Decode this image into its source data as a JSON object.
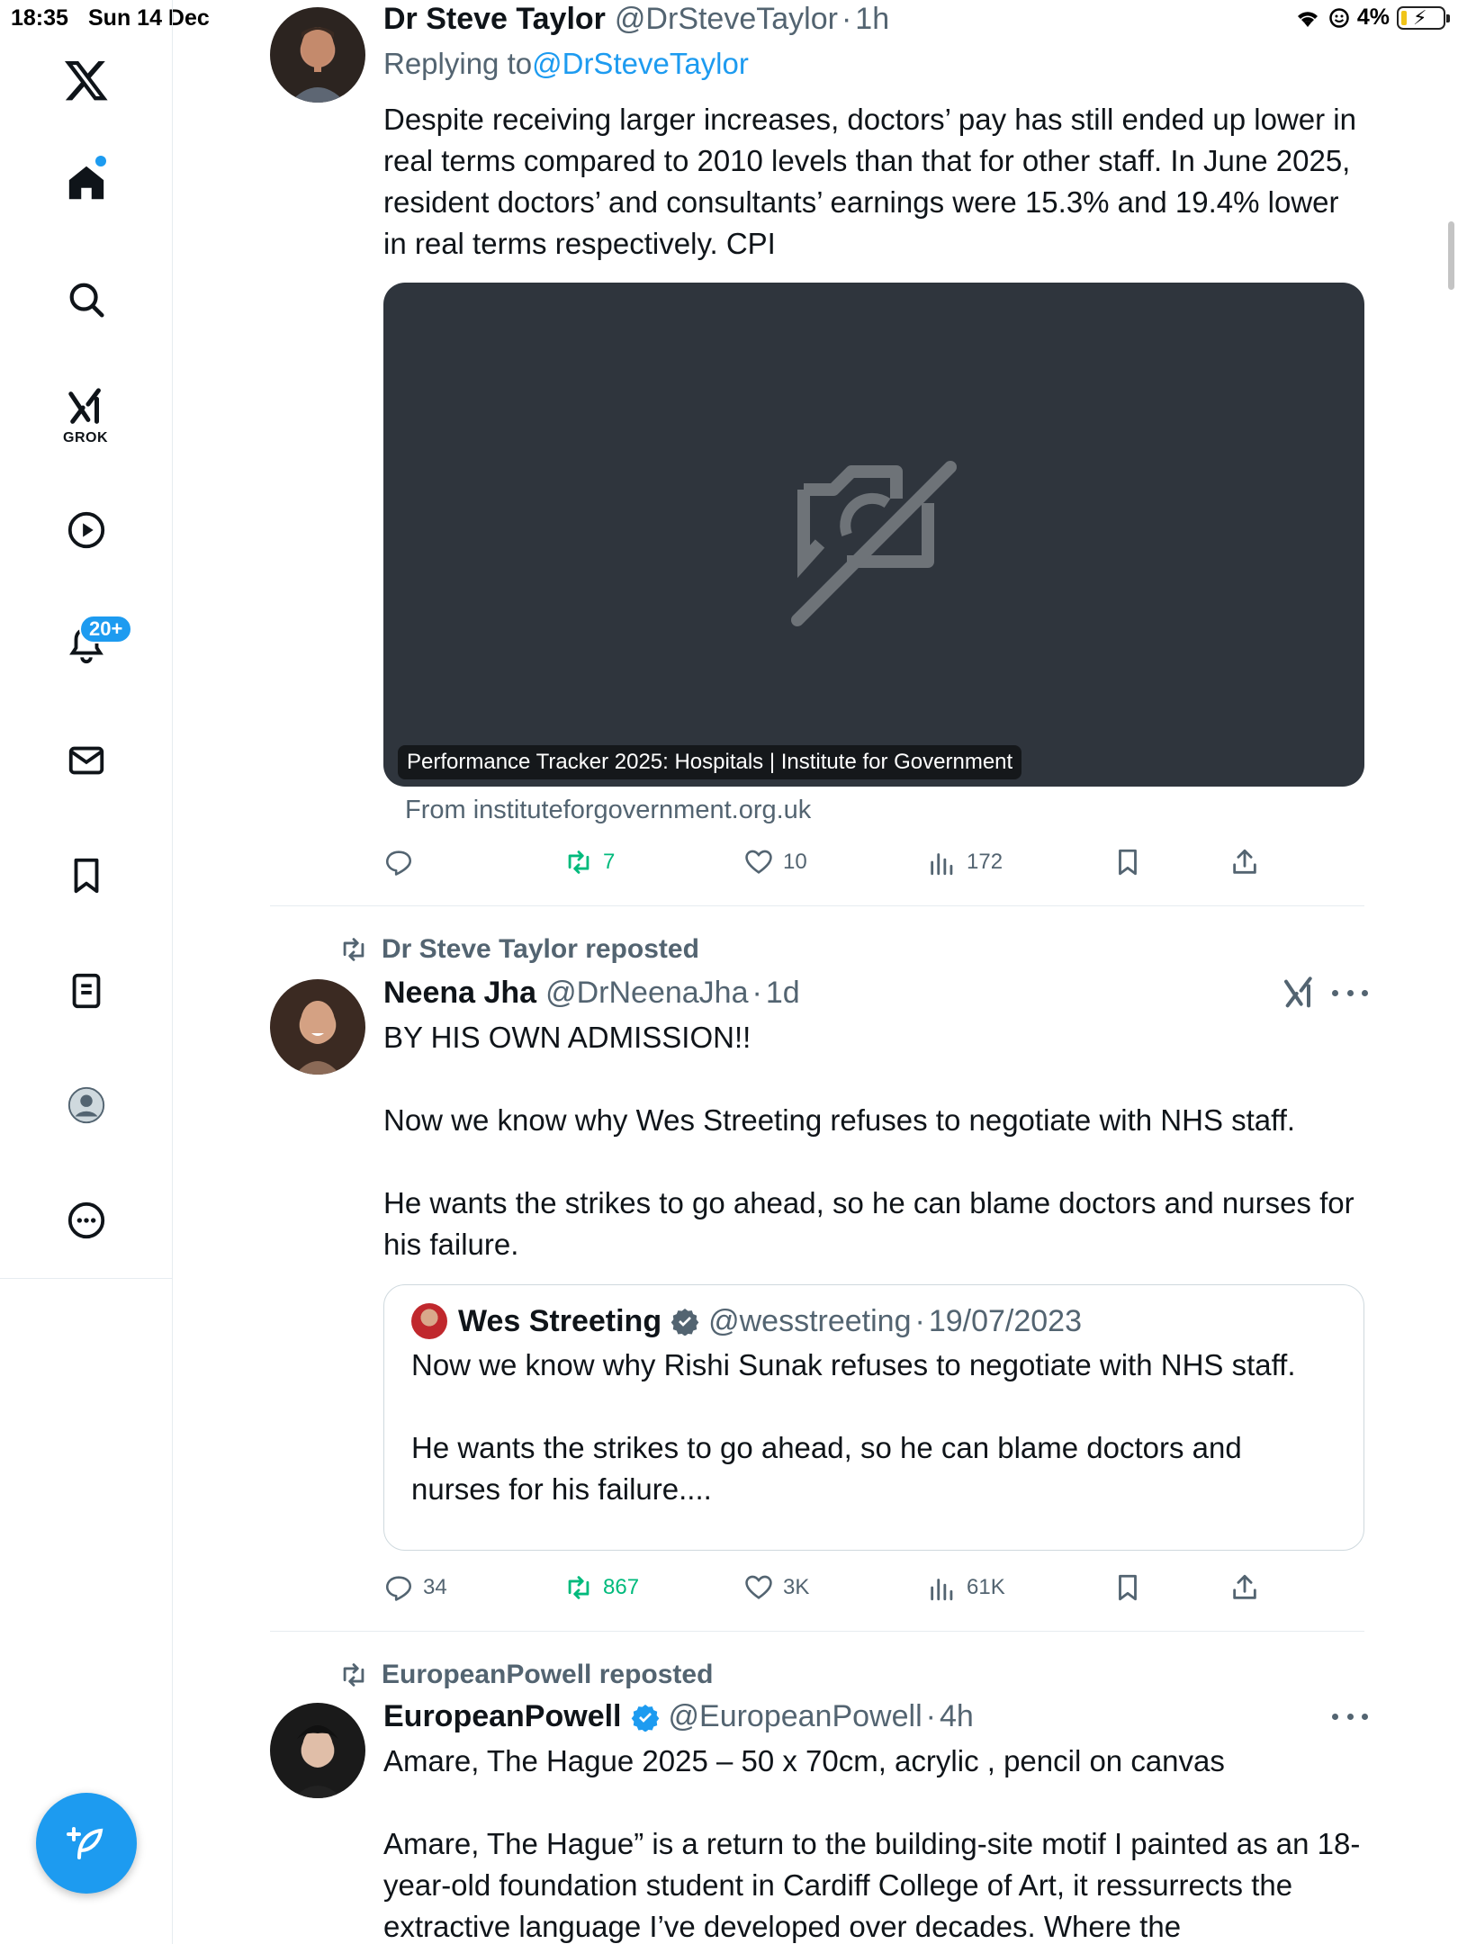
{
  "status_bar": {
    "time": "18:35",
    "date": "Sun 14 Dec",
    "battery": "4%"
  },
  "sidebar": {
    "items": [
      {
        "name": "x-logo"
      },
      {
        "name": "home",
        "has_dot": true
      },
      {
        "name": "search"
      },
      {
        "name": "grok",
        "label": "GROK"
      },
      {
        "name": "video"
      },
      {
        "name": "notifications",
        "badge": "20+"
      },
      {
        "name": "messages"
      },
      {
        "name": "bookmarks"
      },
      {
        "name": "lists"
      },
      {
        "name": "profile"
      },
      {
        "name": "more"
      }
    ]
  },
  "posts": [
    {
      "author": "Dr Steve Taylor",
      "handle": "@DrSteveTaylor",
      "time": "1h",
      "replying_prefix": "Replying to ",
      "replying_to": "@DrSteveTaylor",
      "text": "Despite receiving larger increases, doctors’ pay has still ended up lower in real terms compared to 2010 levels than that for other staff. In June 2025, resident doctors’ and consultants’ earnings were 15.3% and 19.4% lower in real terms respectively. CPI",
      "card": {
        "title": "Performance Tracker 2025: Hospitals | Institute for Government",
        "source": "From instituteforgovernment.org.uk"
      },
      "stats": {
        "replies": "",
        "reposts": "7",
        "likes": "10",
        "views": "172"
      }
    },
    {
      "reposted_by": "Dr Steve Taylor reposted",
      "author": "Neena Jha",
      "handle": "@DrNeenaJha",
      "time": "1d",
      "paragraphs": [
        "BY HIS OWN ADMISSION!!",
        "Now we know why Wes Streeting refuses to negotiate with NHS staff.",
        "He wants the strikes to go ahead, so he can blame doctors and nurses for his failure."
      ],
      "quote": {
        "author": "Wes Streeting",
        "handle": "@wesstreeting",
        "time": "19/07/2023",
        "paragraphs": [
          "Now we know why Rishi Sunak refuses to negotiate with NHS staff.",
          "He wants the strikes to go ahead, so he can blame doctors and nurses for his failure...."
        ]
      },
      "stats": {
        "replies": "34",
        "reposts": "867",
        "likes": "3K",
        "views": "61K"
      }
    },
    {
      "reposted_by": "EuropeanPowell reposted",
      "author": "EuropeanPowell",
      "handle": "@EuropeanPowell",
      "time": "4h",
      "paragraphs": [
        "Amare, The Hague 2025 – 50 x 70cm, acrylic , pencil on canvas",
        "Amare, The Hague” is a return to the building-site motif I painted as an 18-year-old foundation student in Cardiff College of Art, it ressurrects the extractive language I’ve developed over decades. Where the"
      ]
    }
  ],
  "colors": {
    "accent": "#1d9bf0",
    "text": "#0f1419",
    "secondary": "#536471",
    "repost_green": "#00ba7c",
    "card_bg": "#2f353d"
  }
}
